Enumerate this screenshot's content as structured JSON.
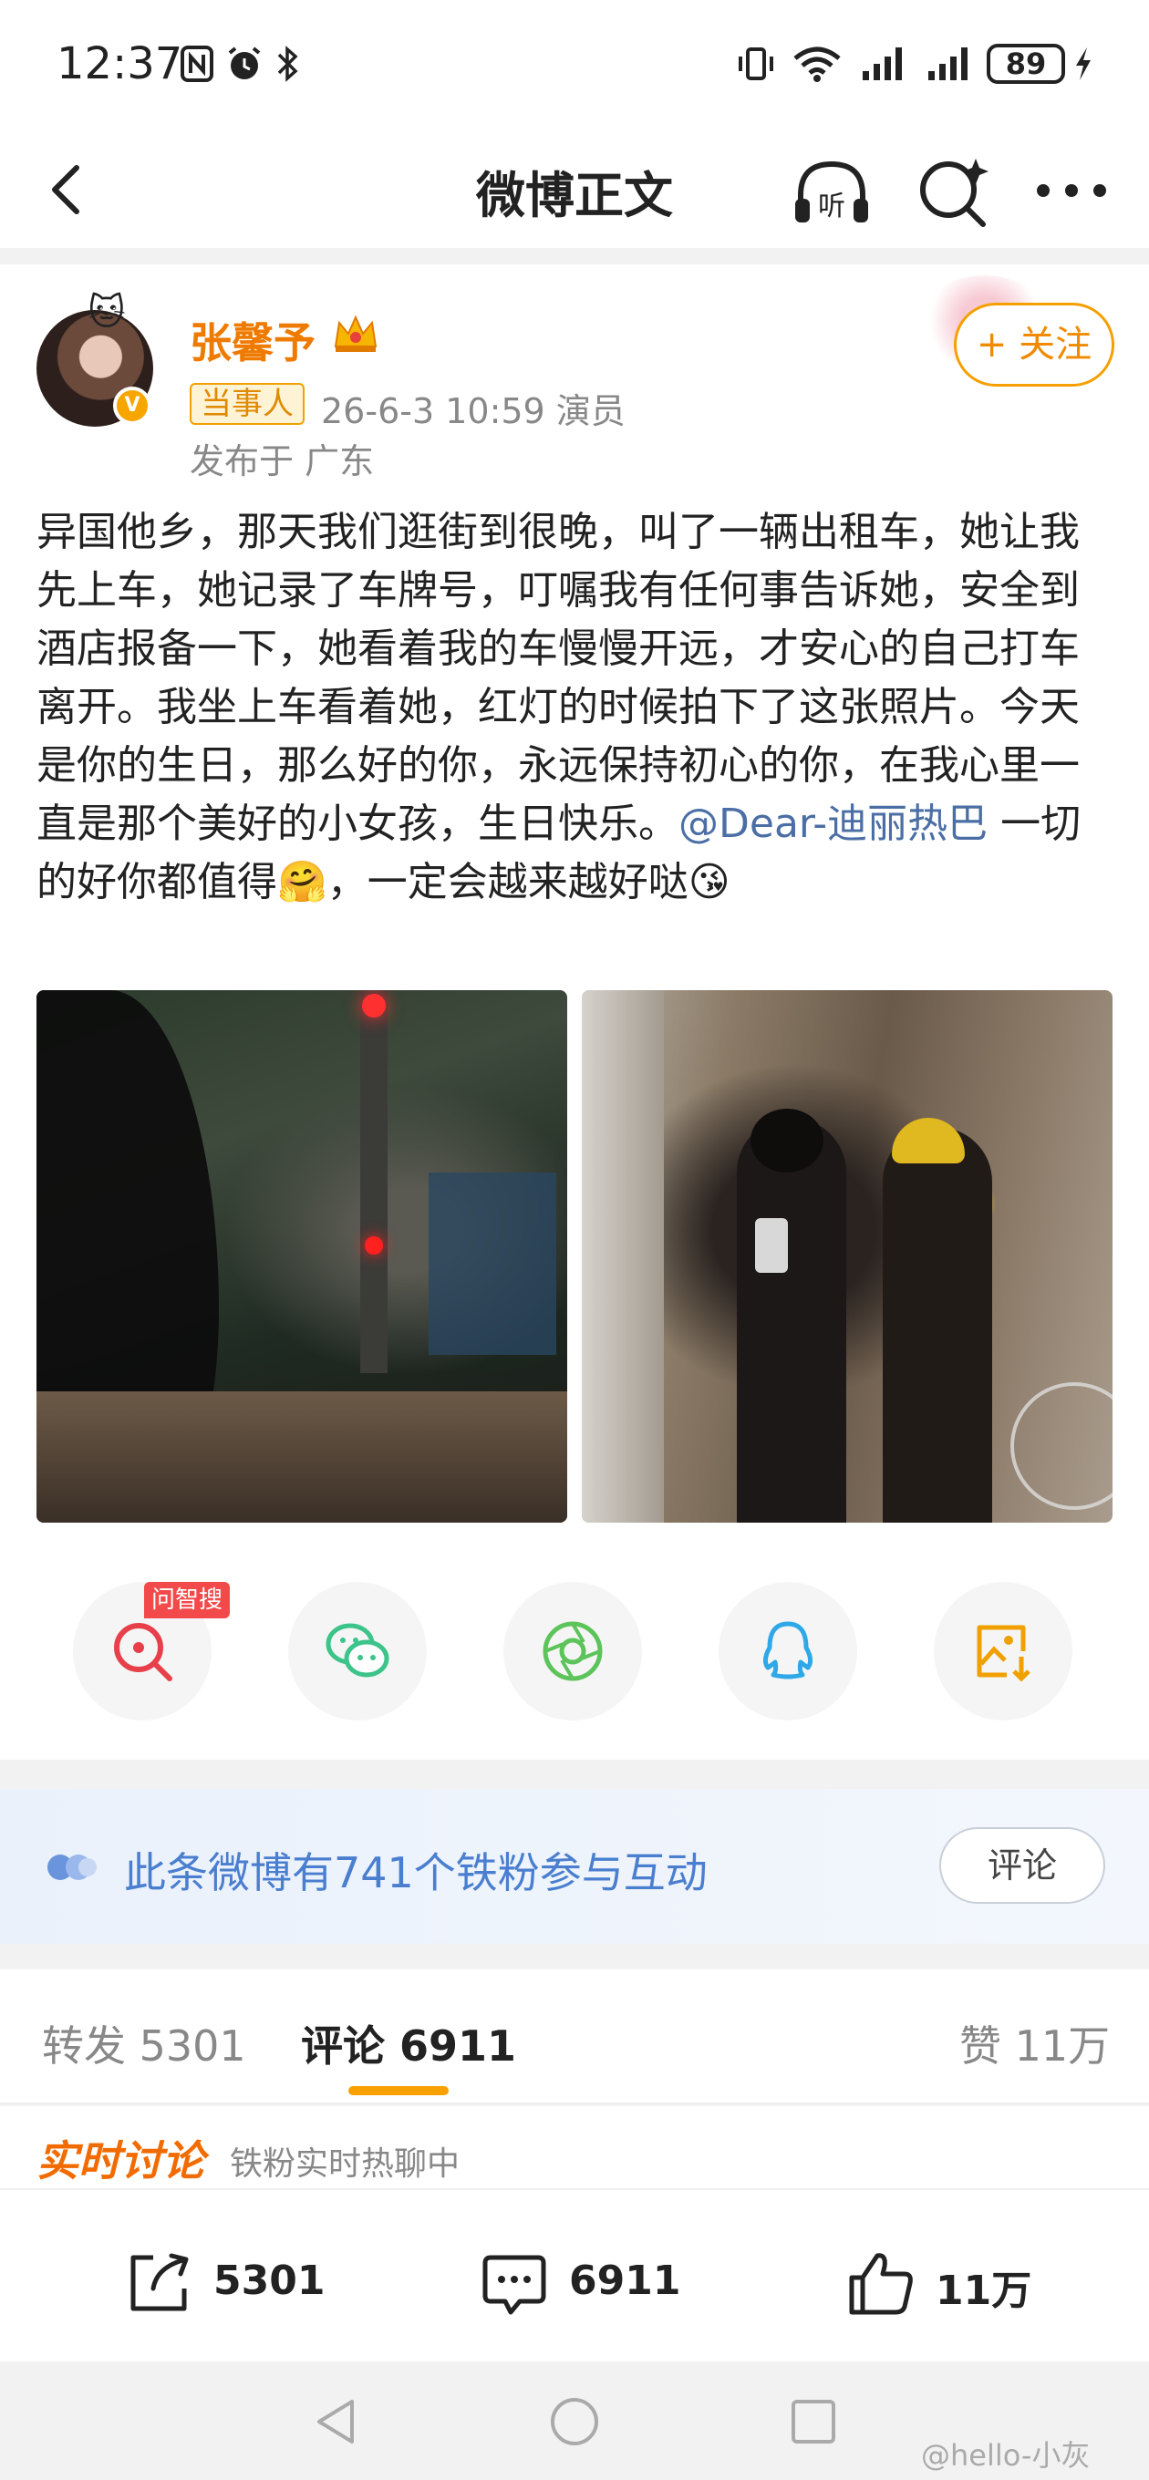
{
  "status_bar": {
    "time": "12:37",
    "battery": "89"
  },
  "nav": {
    "title": "微博正文",
    "listen_label": "听"
  },
  "post": {
    "author": "张馨予",
    "tag": "当事人",
    "meta": "26-6-3 10:59  演员",
    "location": "发布于 广东",
    "follow_label": "+ 关注",
    "text_part1": "异国他乡，那天我们逛街到很晚，叫了一辆出租车，她让我先上车，她记录了车牌号，叮嘱我有任何事告诉她，安全到酒店报备一下，她看着我的车慢慢开远，才安心的自己打车离开。我坐上车看着她，红灯的时候拍下了这张照片。今天是你的生日，那么好的你，永远保持初心的你，在我心里一直是那个美好的小女孩，生日快乐。",
    "mention": "@Dear-迪丽热巴",
    "text_part2": " 一切的好你都值得🤗，一定会越来越好哒😘"
  },
  "share": {
    "ask_badge": "问智搜",
    "icons": [
      "ask-search-icon",
      "wechat-icon",
      "moments-icon",
      "qq-icon",
      "save-image-icon"
    ]
  },
  "fans": {
    "text": "此条微博有741个铁粉参与互动",
    "button": "评论"
  },
  "tabs": {
    "repost": "转发 5301",
    "comment": "评论 6911",
    "like": "赞 11万"
  },
  "realtime": {
    "title": "实时讨论",
    "subtitle": "铁粉实时热聊中"
  },
  "actions": {
    "repost_count": "5301",
    "comment_count": "6911",
    "like_count": "11万"
  },
  "watermark": "@hello-小灰",
  "colors": {
    "brand_orange": "#f08a00",
    "link_blue": "#4b6fa5",
    "fans_blue": "#4a7ecf"
  }
}
